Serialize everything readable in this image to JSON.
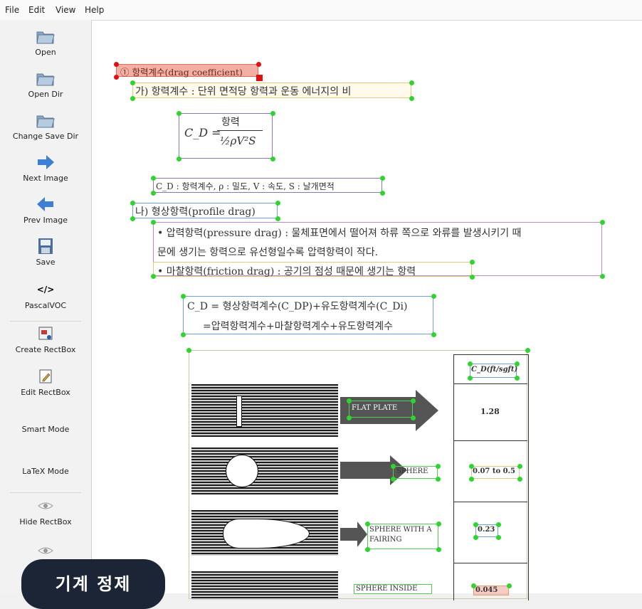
{
  "menu": {
    "file": "File",
    "edit": "Edit",
    "view": "View",
    "help": "Help"
  },
  "toolbar": {
    "open": "Open",
    "open_dir": "Open Dir",
    "change_save_dir": "Change Save Dir",
    "next_image": "Next Image",
    "prev_image": "Prev Image",
    "save": "Save",
    "pascal_voc": "PascalVOC",
    "pascal_voc_glyph": "</>",
    "create_rectbox": "Create RectBox",
    "edit_rectbox": "Edit RectBox",
    "smart_mode": "Smart Mode",
    "latex_mode": "LaTeX Mode",
    "hide_rectbox": "Hide RectBox"
  },
  "document": {
    "heading": "① 항력계수(drag coefficient)",
    "line_ga": "가) 항력계수 : 단위 면적당 항력과 운동 에너지의 비",
    "formula_lhs": "C_D =",
    "formula_num": "항력",
    "formula_den": "½ρV²S",
    "vars_line": "C_D : 항력계수,  ρ : 밀도,  V : 속도,  S : 날개면적",
    "line_na": "나) 형상항력(profile drag)",
    "bullet1_a": "• 압력항력(pressure drag) : 물체표면에서 떨어져 하류 쪽으로 와류를 발생시키기 때",
    "bullet1_b": "문에 생기는 항력으로 유선형일수록 압력항력이 작다.",
    "bullet2": "• 마찰항력(friction drag) : 공기의 점성 때문에 생기는 항력",
    "eq_line1": "C_D = 형상항력계수(C_DP)+유도항력계수(C_Di)",
    "eq_line2": "=압력항력계수+마찰항력계수+유도항력계수",
    "table_header": "C_D(ft/sgft)",
    "rows": [
      {
        "label": "FLAT PLATE",
        "value": "1.28"
      },
      {
        "label": "SPHERE",
        "value": "0.07 to 0.5"
      },
      {
        "label": "SPHERE WITH A FAIRING",
        "value": "0.23"
      },
      {
        "label": "SPHERE INSIDE",
        "value": "0.045"
      }
    ]
  },
  "badge": "기계 정제"
}
